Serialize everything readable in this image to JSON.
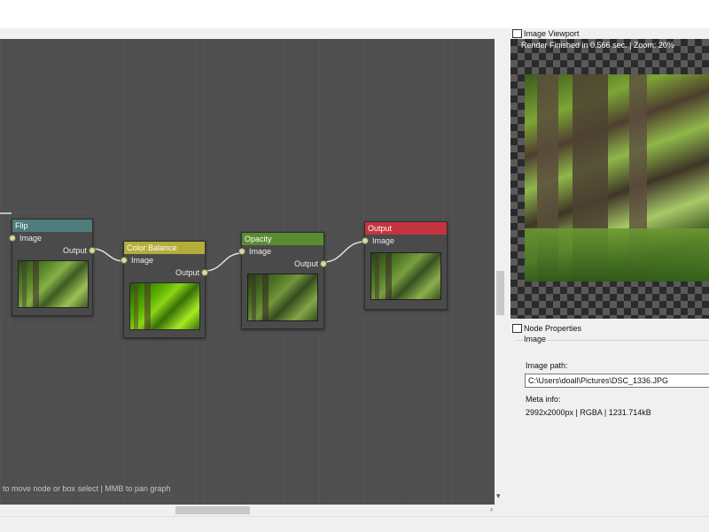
{
  "graph": {
    "hint": "to move node or box select | MMB to pan graph",
    "nodes": {
      "flip": {
        "title": "Flip",
        "input": "Image",
        "output": "Output",
        "color": "#4f7c7c"
      },
      "color_balance": {
        "title": "Color Balance",
        "input": "Image",
        "output": "Output",
        "color": "#b5ad3a"
      },
      "opacity": {
        "title": "Opacity",
        "input": "Image",
        "output": "Output",
        "color": "#5b8c32"
      },
      "output": {
        "title": "Output",
        "input": "Image",
        "color": "#c4343f"
      }
    }
  },
  "image_viewport": {
    "title": "Image Viewport",
    "icon": "image-icon",
    "render_info": "Render Finished in 0.566 sec. | Zoom: 20%"
  },
  "node_properties": {
    "title": "Node Properties",
    "icon": "grid-icon",
    "group_label": "Image",
    "image_path_label": "Image path:",
    "image_path_value": "C:\\Users\\doall\\Pictures\\DSC_1336.JPG",
    "meta_info_label": "Meta info:",
    "meta_info_value": "2992x2000px | RGBA | 1231.714kB"
  }
}
